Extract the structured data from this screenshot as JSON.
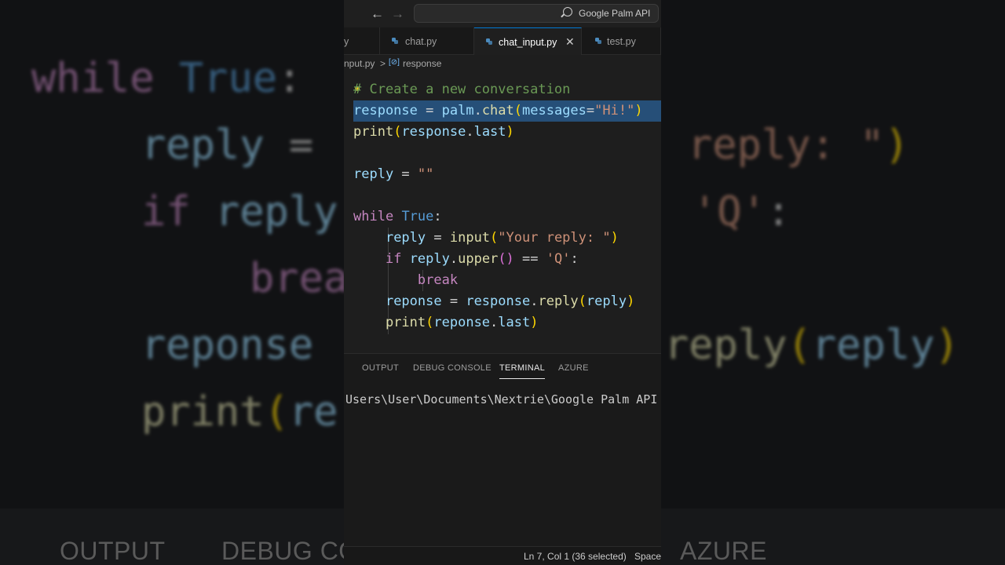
{
  "titlebar": {
    "search_label": "Google Palm API"
  },
  "tabs": [
    {
      "label": "chat.py"
    },
    {
      "label": "chat_input.py",
      "active": true
    },
    {
      "label": "test.py"
    }
  ],
  "tab_close_glyph": "✕",
  "breadcrumb": {
    "file": "nput.py",
    "separator": ">",
    "symbol": "response"
  },
  "code": {
    "comment": "# Create a new conversation",
    "line_selected": "response = palm.chat(messages=\"Hi!\")",
    "status_selection": "Ln 7, Col 1 (36 selected)"
  },
  "panel": {
    "tabs": [
      "OUTPUT",
      "DEBUG CONSOLE",
      "TERMINAL",
      "AZURE"
    ],
    "active_tab": "TERMINAL",
    "terminal_line": "Users\\User\\Documents\\Nextrie\\Google Palm API"
  },
  "statusbar": {
    "position": "Ln 7, Col 1 (36 selected)",
    "indent": "Spaces"
  },
  "background_zoom": {
    "lines": [
      "while True:",
      "reply =",
      "if reply",
      "brea",
      "reponse",
      "print(re"
    ],
    "right_lines": [
      "reply: \")",
      "'Q':",
      "reply(reply)"
    ],
    "panel_tabs": [
      "OUTPUT",
      "DEBUG CO",
      "AZURE"
    ]
  },
  "colors": {
    "keyword": "#c586c0",
    "variable": "#9cdcfe",
    "function": "#dcdcaa",
    "string": "#ce9178",
    "comment": "#6a9955",
    "selection": "#264f78",
    "accent": "#0078d4"
  }
}
